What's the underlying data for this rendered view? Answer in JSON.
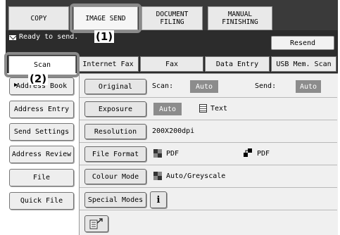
{
  "modes": [
    {
      "label": "COPY"
    },
    {
      "label": "IMAGE SEND"
    },
    {
      "label": "DOCUMENT\nFILING"
    },
    {
      "label": "MANUAL\nFINISHING"
    }
  ],
  "status": {
    "text": "Ready to send.",
    "resend_label": "Resend"
  },
  "tabs": [
    {
      "label": "Scan"
    },
    {
      "label": "Internet Fax"
    },
    {
      "label": "Fax"
    },
    {
      "label": "Data Entry"
    },
    {
      "label": "USB Mem. Scan"
    }
  ],
  "sidebar": {
    "address_book": "Address Book",
    "address_entry": "Address Entry",
    "send_settings": "Send Settings",
    "address_review": "Address Review",
    "file": "File",
    "quick_file": "Quick File"
  },
  "settings": {
    "original_btn": "Original",
    "scan_label": "Scan:",
    "scan_value": "Auto",
    "send_label": "Send:",
    "send_value": "Auto",
    "exposure_btn": "Exposure",
    "exposure_value": "Auto",
    "exposure_type": "Text",
    "resolution_btn": "Resolution",
    "resolution_value": "200X200dpi",
    "file_format_btn": "File Format",
    "file_format_bw": "PDF",
    "file_format_color": "PDF",
    "colour_mode_btn": "Colour Mode",
    "colour_mode_value": "Auto/Greyscale",
    "special_modes_btn": "Special Modes"
  },
  "callouts": {
    "one": "(1)",
    "two": "(2)"
  }
}
